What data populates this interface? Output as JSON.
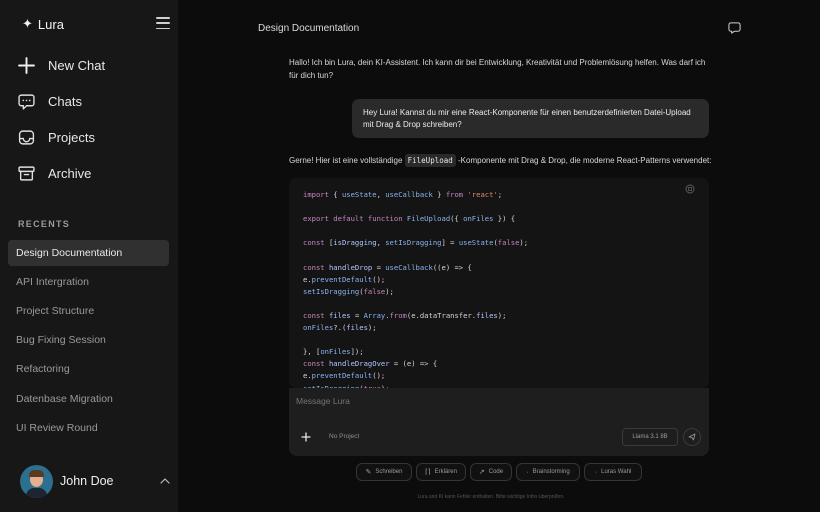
{
  "app": {
    "name": "Lura",
    "logo_glyph": "✦"
  },
  "sidebar": {
    "nav": [
      {
        "label": "New Chat",
        "icon": "plus-icon"
      },
      {
        "label": "Chats",
        "icon": "chat-bubble-icon"
      },
      {
        "label": "Projects",
        "icon": "inbox-tray-icon"
      },
      {
        "label": "Archive",
        "icon": "archive-box-icon"
      }
    ],
    "recents_title": "RECENTS",
    "recents": [
      "Design Documentation",
      "API Intergration",
      "Project Structure",
      "Bug Fixing Session",
      "Refactoring",
      "Datenbase Migration",
      "UI Review Round"
    ],
    "active_recent": "Design Documentation",
    "user": {
      "name": "John Doe"
    }
  },
  "main": {
    "title": "Design Documentation",
    "messages": {
      "ai_greeting": "Hallo! Ich bin Lura, dein KI-Assistent. Ich kann dir bei Entwicklung, Kreativität und Problemlösung helfen. Was darf ich für dich tun?",
      "user_prompt": "Hey Lura! Kannst du mir eine React-Komponente für einen benutzerdefinierten Datei-Upload mit Drag & Drop schreiben?",
      "ai_intro_before": "Gerne! Hier ist eine vollständige ",
      "ai_intro_code": "FileUpload",
      "ai_intro_after": " -Komponente mit Drag & Drop, die moderne React-Patterns verwendet:"
    },
    "code_lines": [
      "import { useState, useCallback } from 'react';",
      "",
      "export default function FileUpload({ onFiles }) {",
      "",
      "const [isDragging, setIsDragging] = useState(false);",
      "",
      "const handleDrop = useCallback((e) => {",
      "e.preventDefault();",
      "setIsDragging(false);",
      "",
      "const files = Array.from(e.dataTransfer.files);",
      "onFiles?.(files);",
      "",
      "}, [onFiles]);",
      "const handleDragOver = (e) => {",
      "e.preventDefault();",
      "setIsDragging(true);"
    ],
    "composer": {
      "placeholder": "Message Lura",
      "project_label": "No Project",
      "model": "Llama 3.1 8B"
    },
    "chips": [
      {
        "label": "Schreiben",
        "icon": "✎"
      },
      {
        "label": "Erklären",
        "icon": "⌈⌉"
      },
      {
        "label": "Code",
        "icon": "↗"
      },
      {
        "label": "Brainstorming",
        "icon": "·"
      },
      {
        "label": "Luras Wahl",
        "icon": "·"
      }
    ],
    "disclaimer": "Lura und KI kann Fehler enthalten. Bitte wichtige Infos überprüfen."
  },
  "colors": {
    "background": "#0c0c0c",
    "sidebar": "#171717",
    "active_item": "#303030"
  }
}
